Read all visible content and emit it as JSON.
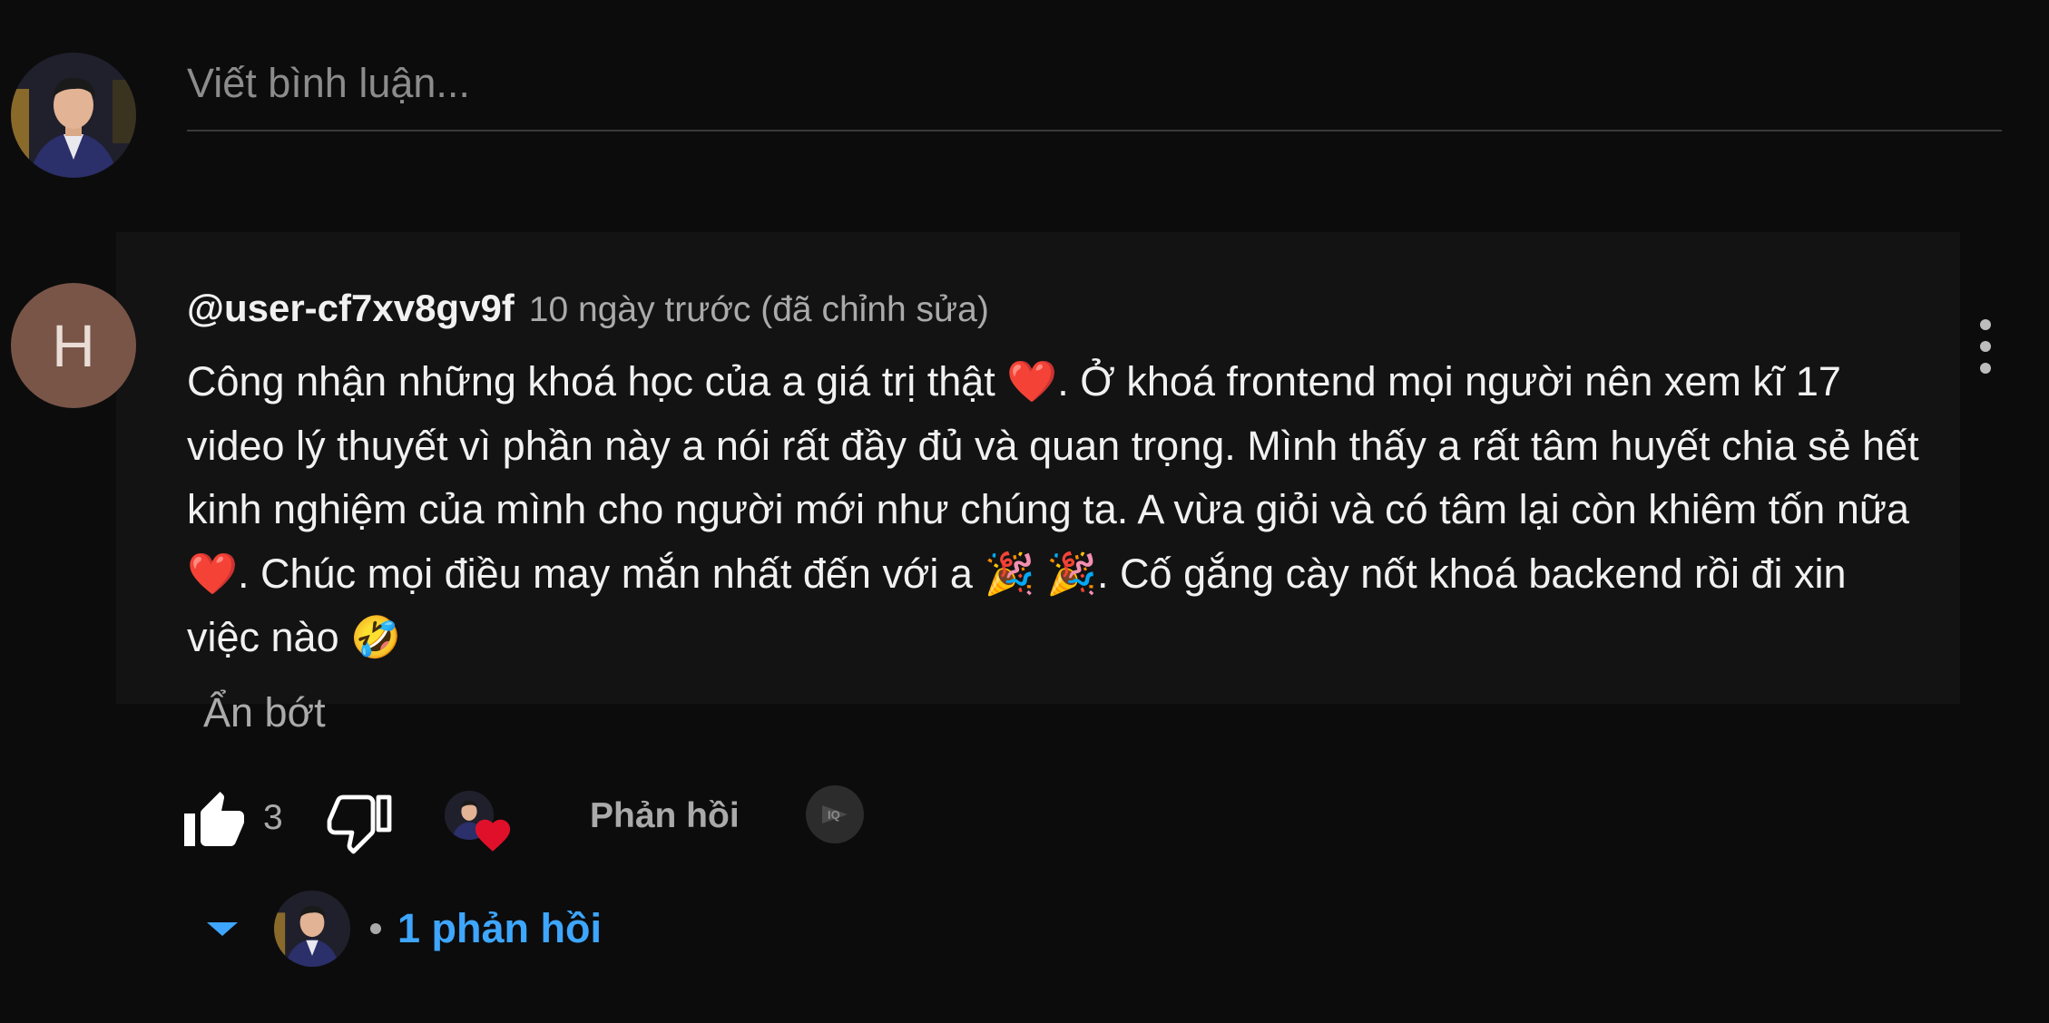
{
  "composer": {
    "placeholder": "Viết bình luận..."
  },
  "comment": {
    "avatar_letter": "H",
    "username": "@user-cf7xv8gv9f",
    "timestamp": "10 ngày trước (đã chỉnh sửa)",
    "body": {
      "p1": "Công nhận những khoá học của a giá trị thật ",
      "heart1": "❤️",
      "p2": ". Ở khoá frontend mọi người nên xem kĩ 17 video lý thuyết vì phần này a nói rất đầy đủ và quan trọng. Mình thấy a rất tâm huyết chia sẻ hết kinh nghiệm của mình cho người mới như chúng ta. A vừa giỏi và có tâm lại còn khiêm tốn nữa ",
      "heart2": "❤️",
      "p3": ". Chúc mọi điều may mắn nhất đến với a ",
      "party1": "🎉",
      "party2": "🎉",
      "p4": ". Cố gắng cày nốt khoá backend rồi đi xin việc nào ",
      "laugh": "🤣"
    },
    "read_less": "Ẩn bớt",
    "like_count": "3",
    "reply_label": "Phản hồi",
    "extra_label": "IQ",
    "replies_label": "1 phản hồi"
  },
  "icons": {
    "like": "thumbs-up-icon",
    "dislike": "thumbs-down-icon",
    "creator_heart": "creator-heart-icon",
    "more": "more-vert-icon",
    "expand": "chevron-down-icon"
  },
  "colors": {
    "background": "#0c0c0c",
    "link_blue": "#3ea6ff",
    "heart_red": "#e0102a",
    "avatar_brown": "#795548"
  }
}
